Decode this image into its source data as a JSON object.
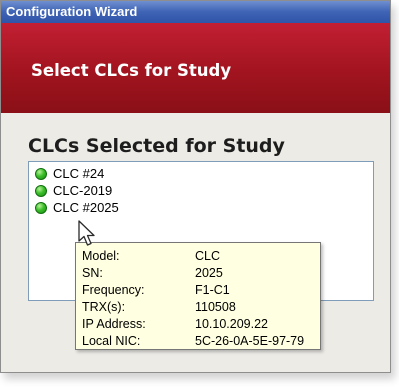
{
  "window": {
    "title": "Configuration Wizard"
  },
  "header": {
    "title": "Select CLCs for Study",
    "band_color": "#a1141f"
  },
  "section": {
    "title": "CLCs Selected for Study"
  },
  "clc_list": {
    "items": [
      {
        "label": "CLC #24",
        "status": "online",
        "status_color": "#3cbf2a"
      },
      {
        "label": "CLC-2019",
        "status": "online",
        "status_color": "#3cbf2a"
      },
      {
        "label": "CLC #2025",
        "status": "online",
        "status_color": "#3cbf2a"
      }
    ]
  },
  "tooltip": {
    "rows": [
      {
        "label": "Model:",
        "value": "CLC"
      },
      {
        "label": "SN:",
        "value": "2025"
      },
      {
        "label": "Frequency:",
        "value": "F1-C1"
      },
      {
        "label": "TRX(s):",
        "value": "110508"
      },
      {
        "label": "IP Address:",
        "value": "10.10.209.22"
      },
      {
        "label": "Local NIC:",
        "value": "5C-26-0A-5E-97-79"
      }
    ]
  },
  "cursor": {
    "icon": "arrow-cursor-icon"
  }
}
